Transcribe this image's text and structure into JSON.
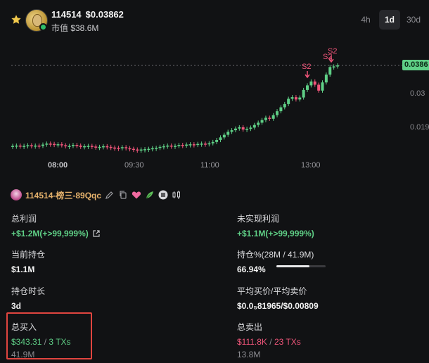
{
  "token": {
    "name": "114514",
    "price": "$0.03862",
    "market_cap": "市值 $38.6M"
  },
  "timeframes": [
    {
      "label": "4h",
      "active": false
    },
    {
      "label": "1d",
      "active": true
    },
    {
      "label": "30d",
      "active": false
    }
  ],
  "chart": {
    "current_price_label": "0.0386",
    "y_ticks": [
      "0.03",
      "0.019"
    ],
    "x_ticks": [
      "08:00",
      "09:30",
      "11:00",
      "13:00"
    ],
    "markers": [
      "S2",
      "S2",
      "S2"
    ],
    "colors": {
      "up": "#5fcf86",
      "down": "#f0557a"
    }
  },
  "chart_data": {
    "type": "candlestick",
    "x_ticks": [
      "08:00",
      "09:30",
      "11:00",
      "13:00"
    ],
    "y_ticks": [
      0.019,
      0.03
    ],
    "current_price": 0.0386,
    "closes": [
      0.014,
      0.0141,
      0.0139,
      0.014,
      0.0142,
      0.0139,
      0.0141,
      0.014,
      0.0144,
      0.0147,
      0.0146,
      0.0143,
      0.0145,
      0.0142,
      0.0139,
      0.014,
      0.0143,
      0.0141,
      0.0137,
      0.0139,
      0.014,
      0.0138,
      0.0136,
      0.0137,
      0.0139,
      0.0137,
      0.0135,
      0.0134,
      0.0133,
      0.0136,
      0.0133,
      0.0131,
      0.0129,
      0.0128,
      0.0129,
      0.013,
      0.0131,
      0.0133,
      0.0134,
      0.0137,
      0.0139,
      0.0141,
      0.0138,
      0.014,
      0.0143,
      0.0142,
      0.0144,
      0.0145,
      0.0143,
      0.0146,
      0.0147,
      0.0145,
      0.0148,
      0.0152,
      0.0158,
      0.0166,
      0.0174,
      0.0183,
      0.0188,
      0.0193,
      0.0197,
      0.019,
      0.0192,
      0.0196,
      0.0204,
      0.0211,
      0.0219,
      0.0226,
      0.0223,
      0.0234,
      0.0246,
      0.0258,
      0.0268,
      0.0284,
      0.0289,
      0.0282,
      0.0288,
      0.0311,
      0.0325,
      0.0337,
      0.0327,
      0.0309,
      0.0334,
      0.0358,
      0.0381,
      0.0383,
      0.0386
    ]
  },
  "wallet": {
    "name": "114514-榜三-89Qqc"
  },
  "stats": {
    "total_profit": {
      "label": "总利润",
      "value": "+$1.2M(+>99,999%)"
    },
    "unrealized_profit": {
      "label": "未实现利润",
      "value": "+$1.1M(+>99,999%)"
    },
    "current_position": {
      "label": "当前持仓",
      "value": "$1.1M"
    },
    "holding_pct": {
      "label": "持仓%(28M / 41.9M)",
      "value": "66.94%",
      "fraction": 0.6694
    },
    "holding_time": {
      "label": "持仓时长",
      "value": "3d"
    },
    "avg_price": {
      "label": "平均买价/平均卖价",
      "value": "$0.0₅81965/$0.00809"
    },
    "total_buy": {
      "label": "总买入",
      "amount": "$343.31",
      "separator": "/",
      "txs": "3 TXs",
      "tokens": "41.9M"
    },
    "total_sell": {
      "label": "总卖出",
      "amount": "$111.8K",
      "separator": "/",
      "txs": "23 TXs",
      "tokens": "13.8M"
    }
  }
}
